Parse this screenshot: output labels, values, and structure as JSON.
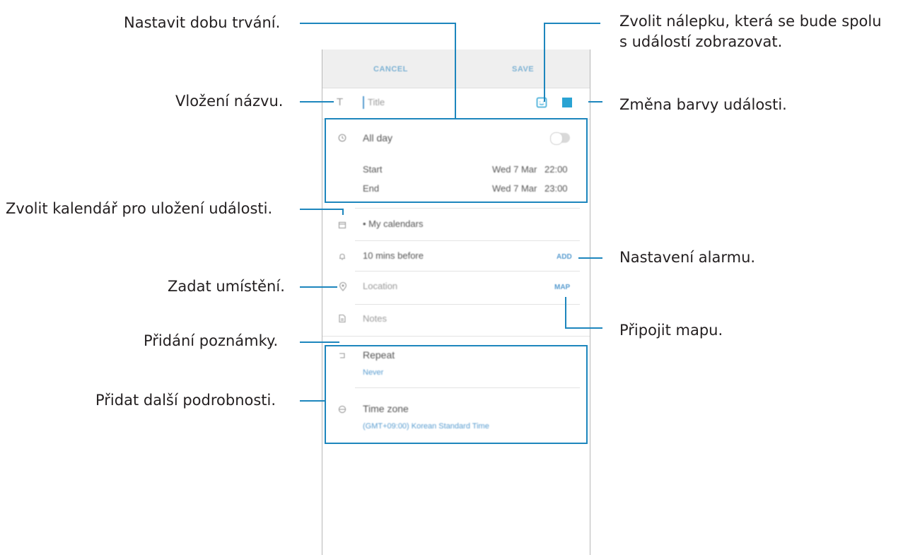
{
  "callouts": {
    "duration": "Nastavit dobu trvání.",
    "sticker_line1": "Zvolit nálepku, která se bude spolu",
    "sticker_line2": "s událostí zobrazovat.",
    "title": "Vložení názvu.",
    "color": "Změna barvy události.",
    "calendar": "Zvolit kalendář pro uložení události.",
    "alarm": "Nastavení alarmu.",
    "location": "Zadat umístění.",
    "map": "Připojit mapu.",
    "notes": "Přidání poznámky.",
    "details": "Přidat další podrobnosti."
  },
  "screen": {
    "topbar": {
      "cancel": "CANCEL",
      "save": "SAVE"
    },
    "title_placeholder": "Title",
    "all_day": "All day",
    "start": {
      "label": "Start",
      "date": "Wed 7 Mar",
      "time": "22:00"
    },
    "end": {
      "label": "End",
      "date": "Wed 7 Mar",
      "time": "23:00"
    },
    "calendar": "• My calendars",
    "reminder": {
      "label": "10 mins before",
      "action": "ADD"
    },
    "location": {
      "placeholder": "Location",
      "action": "MAP"
    },
    "notes_placeholder": "Notes",
    "repeat": {
      "label": "Repeat",
      "value": "Never"
    },
    "time_zone": {
      "label": "Time zone",
      "value": "(GMT+09:00) Korean Standard Time"
    }
  },
  "colors": {
    "accent": "#1d86bd",
    "event_color": "#2aa3d3"
  },
  "icons": [
    "title-icon",
    "clock-icon",
    "sticker-icon",
    "calendar-icon",
    "bell-icon",
    "location-pin-icon",
    "notes-icon",
    "repeat-icon",
    "globe-icon"
  ]
}
